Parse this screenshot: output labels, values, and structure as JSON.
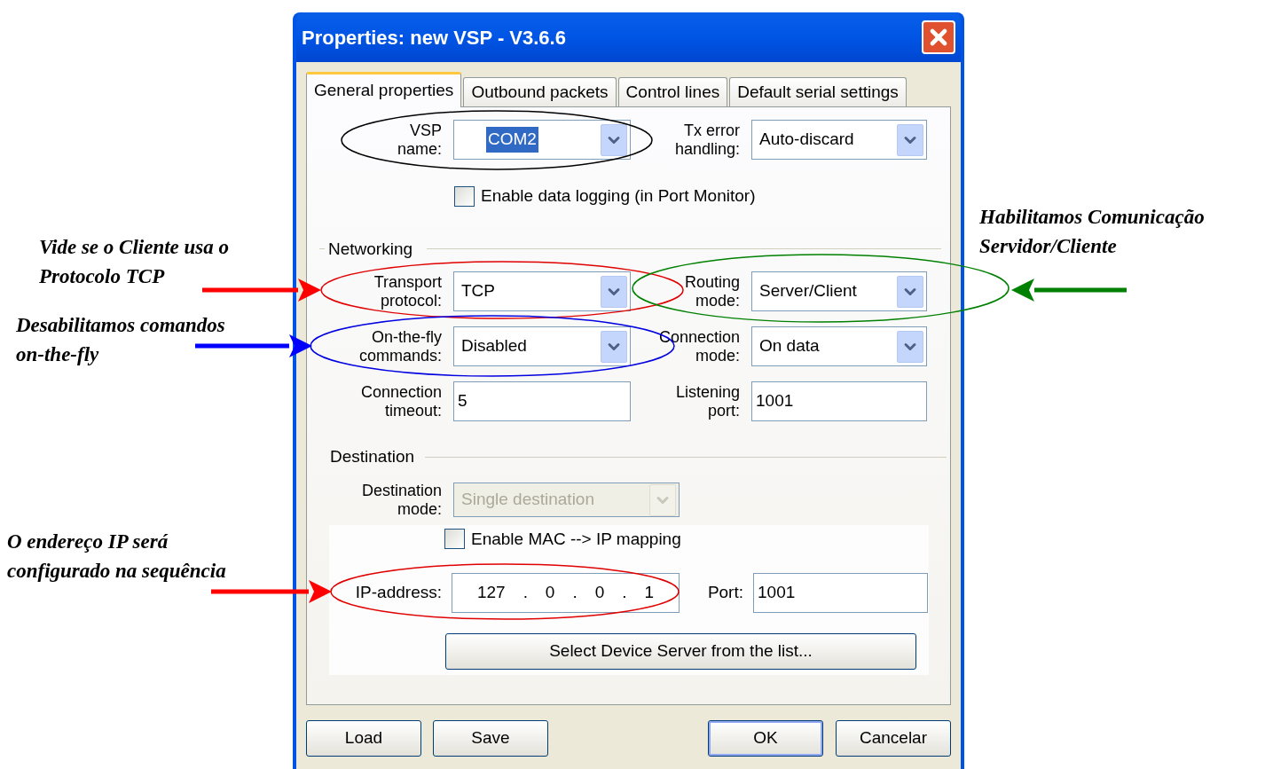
{
  "window": {
    "title": "Properties: new VSP - V3.6.6"
  },
  "tabs": [
    {
      "label": "General properties",
      "selected": true
    },
    {
      "label": "Outbound packets",
      "selected": false
    },
    {
      "label": "Control lines",
      "selected": false
    },
    {
      "label": "Default serial settings",
      "selected": false
    }
  ],
  "general": {
    "fields": [
      {
        "kind": "combo",
        "label": "VSP name:",
        "value": "COM2",
        "highlighted": true
      },
      {
        "kind": "combo",
        "label": "Tx error handling:",
        "value": "Auto-discard",
        "highlighted": false
      }
    ],
    "checkbox": {
      "label": "Enable data logging (in Port Monitor)",
      "checked": false
    }
  },
  "networking": {
    "title": "Networking",
    "fields": [
      {
        "kind": "combo",
        "label": "Transport protocol:",
        "value": "TCP",
        "highlighted": false
      },
      {
        "kind": "combo",
        "label": "Routing mode:",
        "value": "Server/Client",
        "highlighted": false
      },
      {
        "kind": "combo",
        "label": "On-the-fly commands:",
        "value": "Disabled",
        "highlighted": false
      },
      {
        "kind": "combo",
        "label": "Connection mode:",
        "value": "On data",
        "highlighted": false
      },
      {
        "kind": "text",
        "label": "Connection timeout:",
        "value": "5"
      },
      {
        "kind": "text",
        "label": "Listening port:",
        "value": "1001"
      }
    ]
  },
  "destination": {
    "title": "Destination",
    "mode": {
      "label": "Destination mode:",
      "value": "Single destination",
      "disabled": true
    },
    "checkbox": {
      "label": "Enable MAC --> IP mapping",
      "checked": false
    },
    "ip_label": "IP-address:",
    "ip_parts": [
      "127",
      ".",
      "0",
      ".",
      "0",
      ".",
      "1"
    ],
    "port_label": "Port:",
    "port_value": "1001",
    "select_button": "Select Device Server from the list..."
  },
  "buttons": [
    {
      "label": "Load",
      "default": false
    },
    {
      "label": "Save",
      "default": false
    },
    {
      "label": "OK",
      "default": true
    },
    {
      "label": "Cancelar",
      "default": false
    }
  ],
  "highlights": [
    {
      "color": "#000000"
    },
    {
      "color": "#e00000"
    },
    {
      "color": "#008000"
    },
    {
      "color": "#0000e0"
    },
    {
      "color": "#e00000"
    }
  ],
  "annotations": [
    {
      "text": "Habilitamos Comunicação Servidor/Cliente",
      "color": "#008000"
    },
    {
      "text": "Vide se o Cliente usa o Protocolo TCP",
      "color": "#ff0000"
    },
    {
      "text": "Desabilitamos comandos on-the-fly",
      "color": "#0000ff"
    },
    {
      "text": "O endereço IP será configurado na sequência",
      "color": "#ff0000"
    }
  ]
}
